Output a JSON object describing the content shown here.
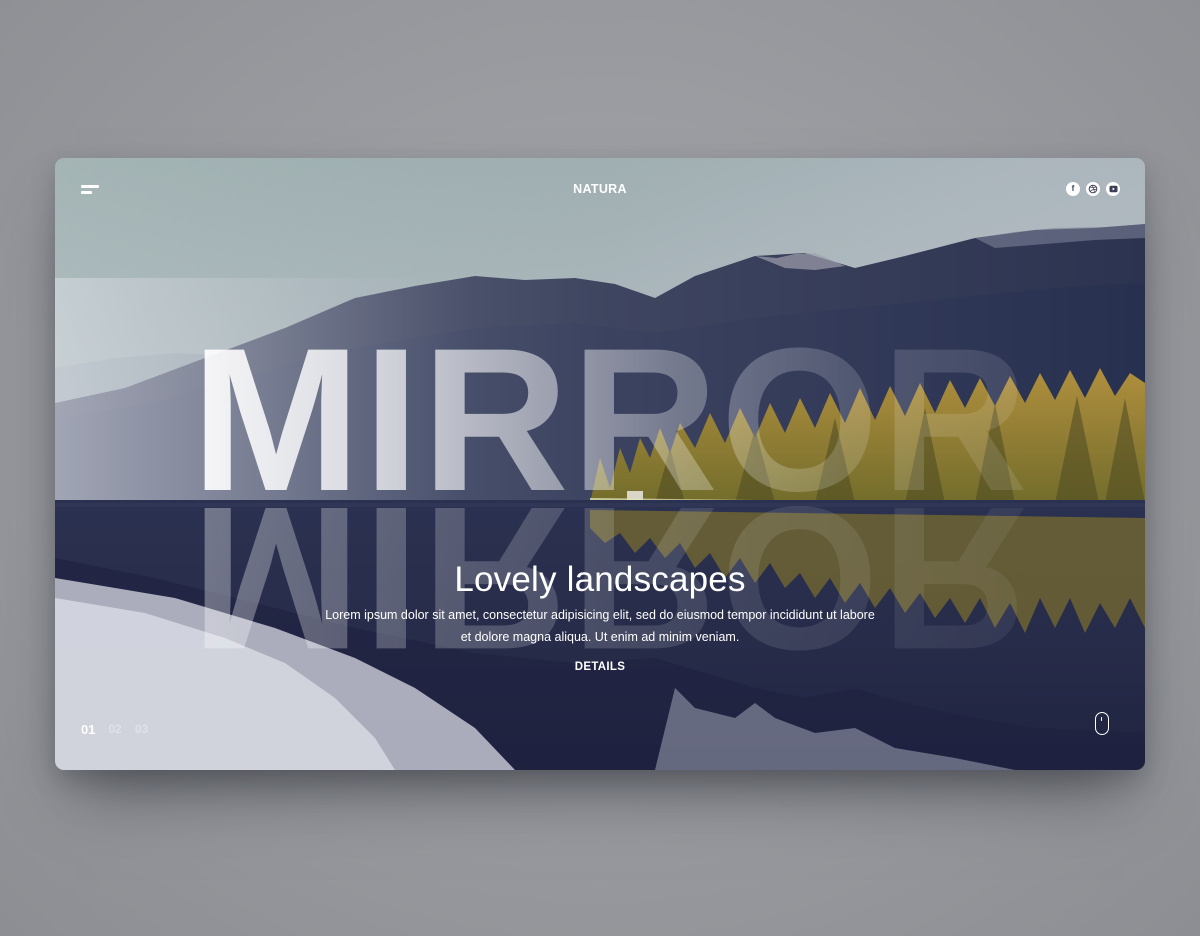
{
  "header": {
    "brand": "NATURA",
    "socials": [
      "facebook-icon",
      "dribbble-icon",
      "youtube-icon"
    ],
    "facebook_glyph": "f"
  },
  "hero": {
    "big_word": "MIRROR",
    "title": "Lovely landscapes",
    "body": "Lorem ipsum dolor sit amet, consectetur adipisicing elit, sed do eiusmod tempor incididunt ut labore et dolore magna aliqua. Ut enim ad minim veniam.",
    "cta": "DETAILS"
  },
  "pager": {
    "slides": [
      "01",
      "02",
      "03"
    ],
    "active": "01"
  },
  "colors": {
    "sky": "#8fa3a6",
    "mountains": "#2c3350",
    "forest": "#8a7a30",
    "water": "#2a2f4d",
    "text": "#ffffff"
  }
}
